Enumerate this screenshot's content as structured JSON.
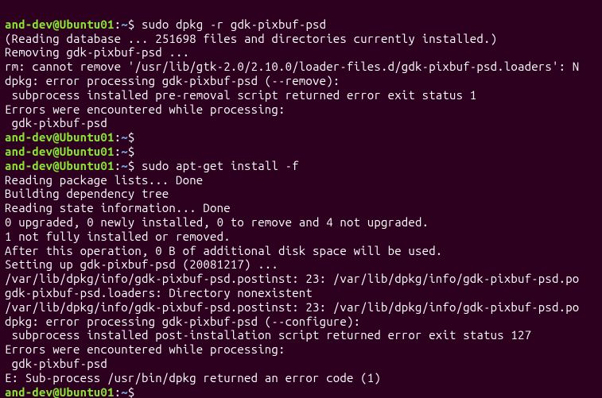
{
  "prompts": {
    "user_host": "and-dev@Ubuntu01",
    "sep": ":",
    "path": "~",
    "end": "$"
  },
  "commands": {
    "c1": "sudo dpkg -r gdk-pixbuf-psd",
    "c2": "",
    "c3": "",
    "c4": "sudo apt-get install -f",
    "c5": ""
  },
  "output": {
    "l01": "(Reading database ... 251698 files and directories currently installed.)",
    "l02": "Removing gdk-pixbuf-psd ...",
    "l03": "rm: cannot remove '/usr/lib/gtk-2.0/2.10.0/loader-files.d/gdk-pixbuf-psd.loaders': N",
    "l04": "dpkg: error processing gdk-pixbuf-psd (--remove):",
    "l05": " subprocess installed pre-removal script returned error exit status 1",
    "l06": "Errors were encountered while processing:",
    "l07": " gdk-pixbuf-psd",
    "l08": "Reading package lists... Done",
    "l09": "Building dependency tree",
    "l10": "Reading state information... Done",
    "l11": "0 upgraded, 0 newly installed, 0 to remove and 4 not upgraded.",
    "l12": "1 not fully installed or removed.",
    "l13": "After this operation, 0 B of additional disk space will be used.",
    "l14": "Setting up gdk-pixbuf-psd (20081217) ...",
    "l15": "/var/lib/dpkg/info/gdk-pixbuf-psd.postinst: 23: /var/lib/dpkg/info/gdk-pixbuf-psd.po",
    "l16": "gdk-pixbuf-psd.loaders: Directory nonexistent",
    "l17": "/var/lib/dpkg/info/gdk-pixbuf-psd.postinst: 23: /var/lib/dpkg/info/gdk-pixbuf-psd.po",
    "l18": "dpkg: error processing gdk-pixbuf-psd (--configure):",
    "l19": " subprocess installed post-installation script returned error exit status 127",
    "l20": "Errors were encountered while processing:",
    "l21": " gdk-pixbuf-psd",
    "l22": "E: Sub-process /usr/bin/dpkg returned an error code (1)"
  }
}
